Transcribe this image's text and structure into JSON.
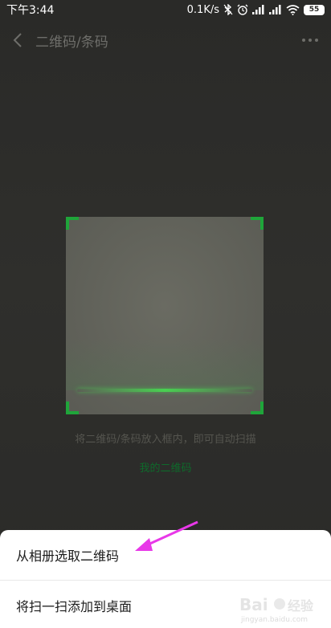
{
  "status_bar": {
    "time": "下午3:44",
    "speed": "0.1K/s",
    "battery": "55"
  },
  "nav": {
    "title": "二维码/条码"
  },
  "scanner": {
    "hint": "将二维码/条码放入框内，即可自动扫描",
    "my_qr_link": "我的二维码",
    "accent_color": "#1fa53a"
  },
  "sheet": {
    "items": [
      {
        "label": "从相册选取二维码"
      },
      {
        "label": "将扫一扫添加到桌面"
      }
    ]
  },
  "annotation": {
    "arrow_color": "#e838e8"
  },
  "watermark": {
    "brand": "Bai du 经验",
    "url": "jingyan.baidu.com"
  },
  "icons": [
    "back-icon",
    "more-icon",
    "bluetooth-icon",
    "alarm-icon",
    "signal-icon",
    "wifi-icon",
    "battery-icon"
  ]
}
